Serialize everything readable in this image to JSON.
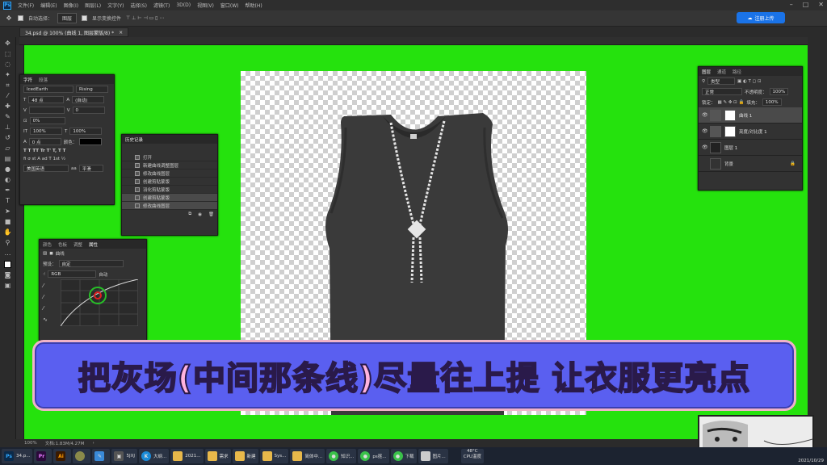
{
  "menu": {
    "items": [
      "文件(F)",
      "编辑(E)",
      "图像(I)",
      "图层(L)",
      "文字(Y)",
      "选择(S)",
      "滤镜(T)",
      "3D(D)",
      "视图(V)",
      "窗口(W)",
      "帮助(H)"
    ]
  },
  "options": {
    "auto_select_label": "自动选择：",
    "auto_select_value": "图层",
    "show_transform_label": "显示变换控件",
    "cloud_label": "注册上传"
  },
  "document": {
    "tab_title": "34.psd @ 100% (曲线 1, 图层蒙版/8) *"
  },
  "character_panel": {
    "tabs": [
      "字符",
      "段落"
    ],
    "font": "IcedEarth",
    "style": "Rising",
    "size": "48 点",
    "leading": "(自动)",
    "tracking": "0",
    "kerning": "0%",
    "vscale": "100%",
    "hscale": "100%",
    "baseline": "0 点",
    "color_label": "颜色：",
    "lang": "美国英语",
    "aa": "平滑"
  },
  "history_panel": {
    "title": "历史记录",
    "items": [
      "打开",
      "新建曲线调整图层",
      "修改曲线图层",
      "创建剪贴蒙版",
      "羽化剪贴蒙版",
      "创建剪贴蒙版",
      "修改曲线图层"
    ]
  },
  "properties_panel": {
    "tabs": [
      "颜色",
      "色板",
      "调整",
      "属性"
    ],
    "title": "曲线",
    "preset_label": "预设：",
    "preset_value": "自定",
    "channel": "RGB",
    "auto": "自动"
  },
  "layers_panel": {
    "tabs": [
      "图层",
      "通道",
      "路径"
    ],
    "kind": "类型",
    "blend": "正常",
    "opacity_label": "不透明度：",
    "opacity": "100%",
    "lock_label": "锁定：",
    "fill_label": "填充：",
    "fill": "100%",
    "layers": [
      {
        "name": "曲线 1",
        "selected": true
      },
      {
        "name": "亮度/对比度 1",
        "selected": false
      },
      {
        "name": "图层 1",
        "selected": false
      },
      {
        "name": "背景",
        "selected": false
      }
    ]
  },
  "caption": "把灰场(中间那条线)尽量往上提 让衣服更亮点",
  "status": {
    "zoom": "100%",
    "doc": "文档:1.83M/4.27M"
  },
  "taskbar": {
    "items": [
      "34.p...",
      "",
      "",
      "",
      "",
      "5JXJ",
      "大纲...",
      "2021...",
      "需求",
      "新建",
      "Sys...",
      "简体中...",
      "知识...",
      "ps抠...",
      "下载",
      "图片..."
    ],
    "cpu_temp": "48°C",
    "cpu_label": "CPU温度",
    "date": "2021/10/29"
  },
  "colors": {
    "green": "#25e20d",
    "caption_bg": "#5a5ff0",
    "caption_text": "#ffb3de"
  }
}
